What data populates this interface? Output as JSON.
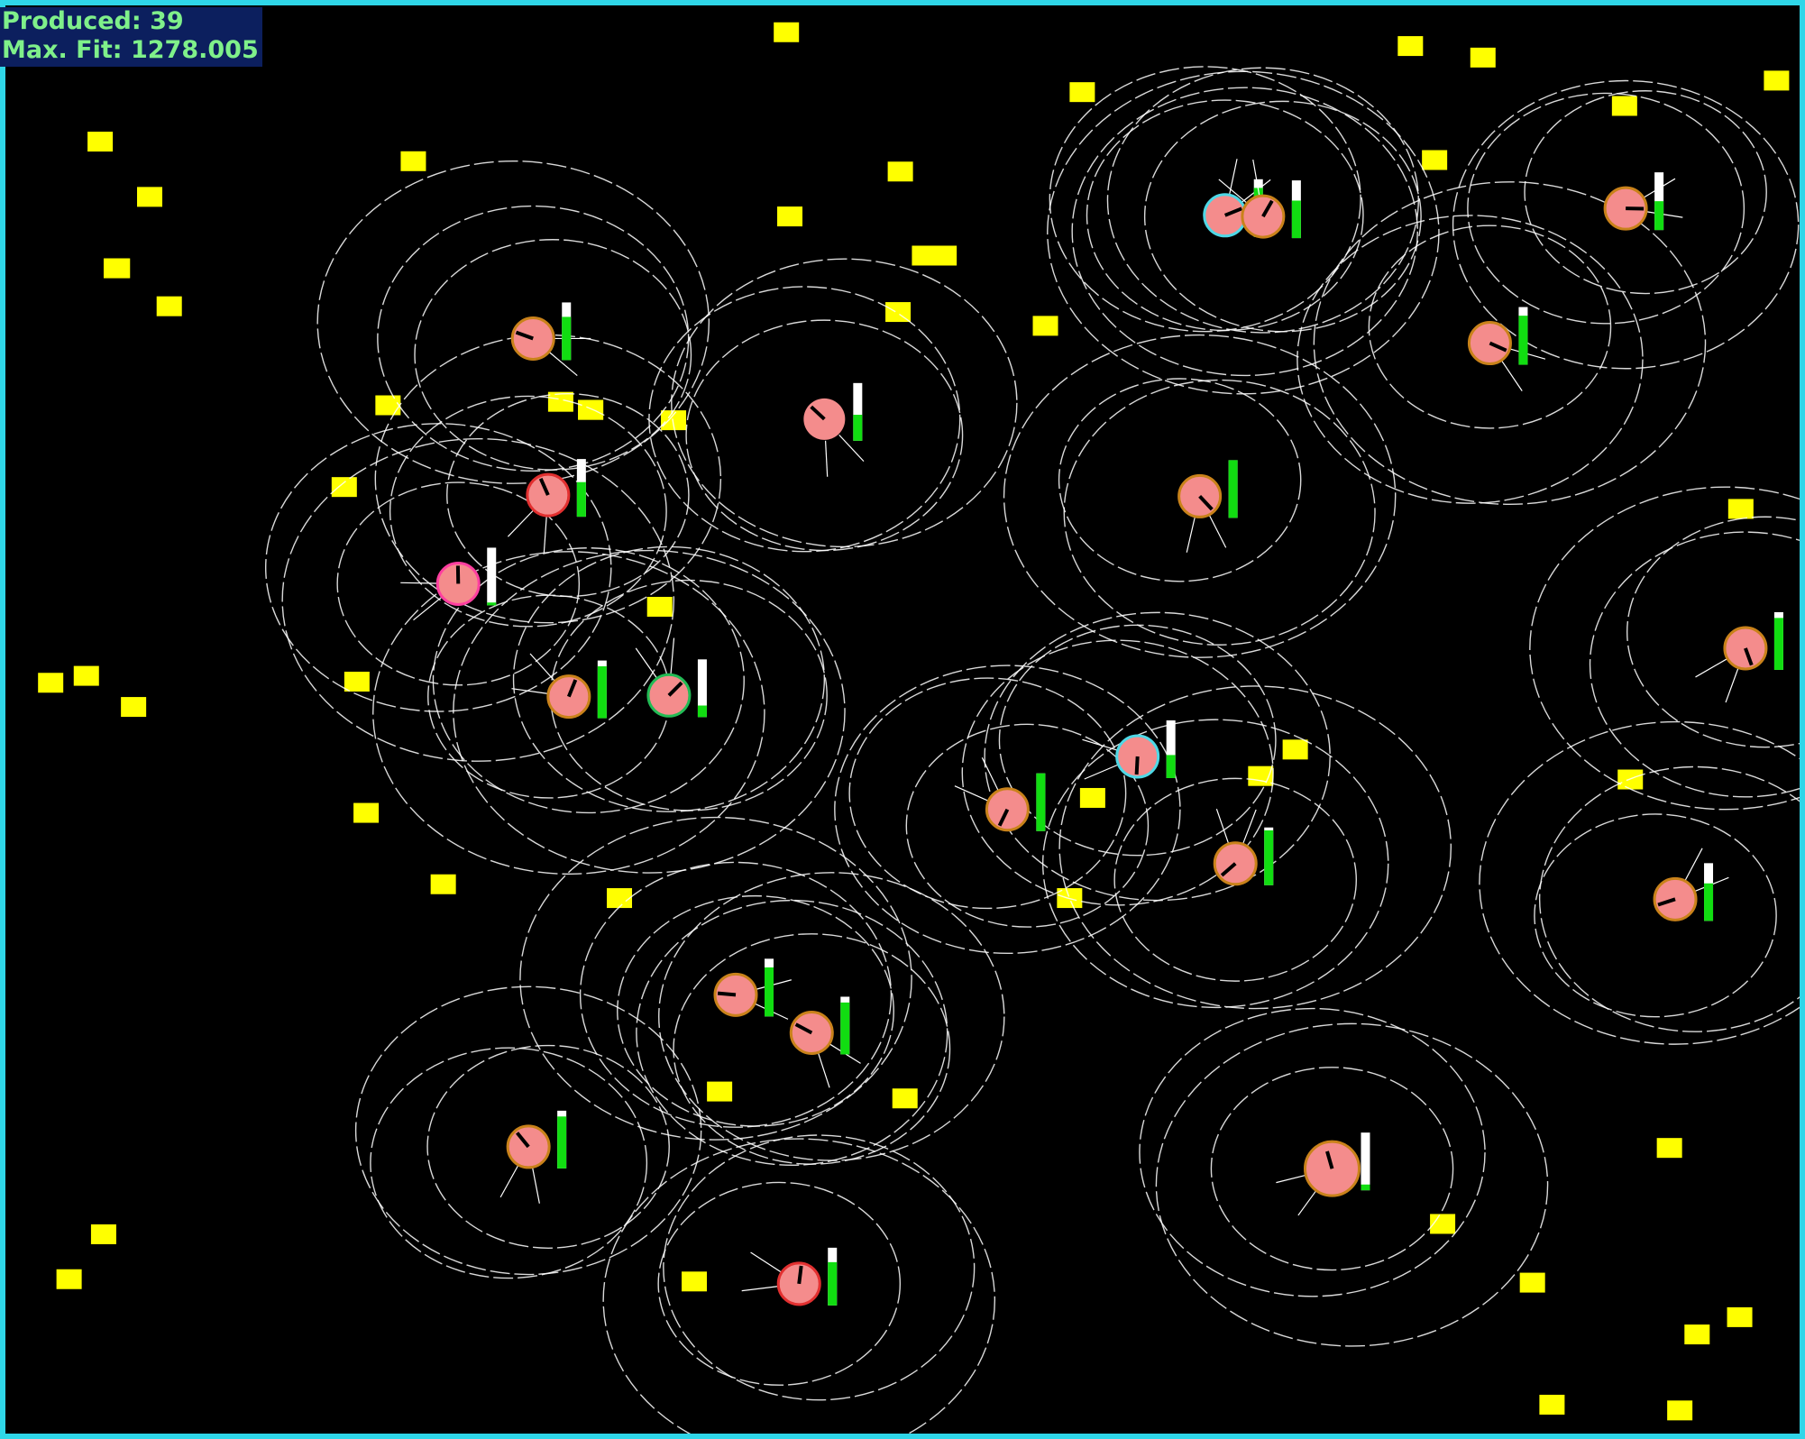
{
  "hud": {
    "produced_label": "Produced:",
    "produced_value": "39",
    "max_fit_label": "Max. Fit:",
    "max_fit_value": "1278.005"
  },
  "colors": {
    "frame": "#2fd6e8",
    "background": "#000000",
    "food": "#ffff00",
    "agent_body": "#f48c8c",
    "energy_full": "#ffffff",
    "energy_level": "#11dd11",
    "sensor_ring": "#ffffff",
    "hud_text": "#7ff08a",
    "hud_bg": "#0c1f5e"
  },
  "agents": [
    {
      "id": 1,
      "energy": 0.75,
      "ring": "orange"
    },
    {
      "id": 2,
      "energy": 0.45,
      "ring": "none"
    },
    {
      "id": 3,
      "energy": 0.6,
      "ring": "red"
    },
    {
      "id": 4,
      "energy": 0.05,
      "ring": "pink"
    },
    {
      "id": 5,
      "energy": 0.9,
      "ring": "orange"
    },
    {
      "id": 6,
      "energy": 0.2,
      "ring": "green"
    },
    {
      "id": 7,
      "energy": 0.85,
      "ring": "cyan"
    },
    {
      "id": 8,
      "energy": 0.5,
      "ring": "orange"
    },
    {
      "id": 9,
      "energy": 0.85,
      "ring": "orange"
    },
    {
      "id": 10,
      "energy": 1.0,
      "ring": "orange"
    },
    {
      "id": 11,
      "energy": 0.9,
      "ring": "orange"
    },
    {
      "id": 12,
      "energy": 0.4,
      "ring": "cyan"
    },
    {
      "id": 13,
      "energy": 1.0,
      "ring": "orange"
    },
    {
      "id": 14,
      "energy": 0.95,
      "ring": "orange"
    },
    {
      "id": 15,
      "energy": 0.65,
      "ring": "orange"
    },
    {
      "id": 16,
      "energy": 0.85,
      "ring": "orange"
    },
    {
      "id": 17,
      "energy": 0.9,
      "ring": "orange"
    },
    {
      "id": 18,
      "energy": 0.9,
      "ring": "orange"
    },
    {
      "id": 19,
      "energy": 0.1,
      "ring": "orange"
    },
    {
      "id": 20,
      "energy": 0.75,
      "ring": "red"
    },
    {
      "id": 21,
      "energy": 0.65,
      "ring": "orange"
    }
  ],
  "food_count": 52
}
